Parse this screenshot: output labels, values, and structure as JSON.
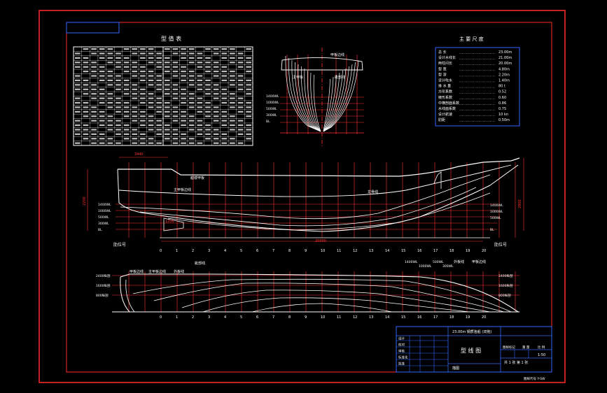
{
  "offset_table": {
    "title": "型 值 表"
  },
  "principal_dimensions": {
    "title": "主 要 尺 度",
    "rows": [
      {
        "label": "总 长",
        "value": "23.00m"
      },
      {
        "label": "设计水线长",
        "value": "21.00m"
      },
      {
        "label": "两柱间长",
        "value": "20.00m"
      },
      {
        "label": "型 宽",
        "value": "4.80m"
      },
      {
        "label": "型 深",
        "value": "2.20m"
      },
      {
        "label": "设计吃水",
        "value": "1.40m"
      },
      {
        "label": "排 水 量",
        "value": "80 t"
      },
      {
        "label": "方形系数",
        "value": "0.52"
      },
      {
        "label": "棱形系数",
        "value": "0.60"
      },
      {
        "label": "中横剖面系数",
        "value": "0.86"
      },
      {
        "label": "水线面系数",
        "value": "0.75"
      },
      {
        "label": "设计航速",
        "value": "10 kn"
      },
      {
        "label": "肋距",
        "value": "0.50m"
      }
    ]
  },
  "body_plan": {
    "labels": [
      "甲板边线",
      "主甲板",
      "舭部线"
    ],
    "waterlines": [
      "1400WL",
      "1000WL",
      "500WL",
      "300WL",
      "BL"
    ]
  },
  "profile": {
    "labels": [
      "艏楼甲板",
      "主甲板边线",
      "龙骨线"
    ],
    "waterlines_left": [
      "1400WL",
      "1000WL",
      "500WL",
      "300WL",
      "BL"
    ],
    "waterlines_right": [
      "1400WL",
      "1000WL",
      "500WL",
      "BL"
    ],
    "station_caption": "肋位号",
    "station_numbers": [
      "0",
      "1",
      "2",
      "3",
      "4",
      "5",
      "6",
      "7",
      "8",
      "9",
      "10",
      "11",
      "12",
      "13",
      "14",
      "15",
      "16",
      "17",
      "18",
      "19",
      "20"
    ],
    "dims": [
      "3440",
      "2200",
      "2800",
      "20000",
      "1200"
    ]
  },
  "half_breadth": {
    "labels": [
      "甲板边线",
      "主甲板边线",
      "外板线",
      "舭部线",
      "1400WL",
      "1000WL",
      "500WL",
      "300WL",
      "外板线",
      "甲板边线"
    ],
    "buttocks": [
      "2400纵剖",
      "1600纵剖",
      "800纵剖"
    ]
  },
  "title_block": {
    "project": "23.00m 钢质渔船 (双拖)",
    "drawing_name": "型 线 图",
    "scale_label": "比 例",
    "scale": "1:50",
    "sheet": "共 1 张 第 1 张",
    "mark_label": "图样标记",
    "weight_label": "重 量",
    "rows": [
      "设计",
      "校对",
      "审核",
      "标准化",
      "批准"
    ],
    "footer_label": "描图",
    "drawing_no": "图样代号 Y-SW"
  }
}
